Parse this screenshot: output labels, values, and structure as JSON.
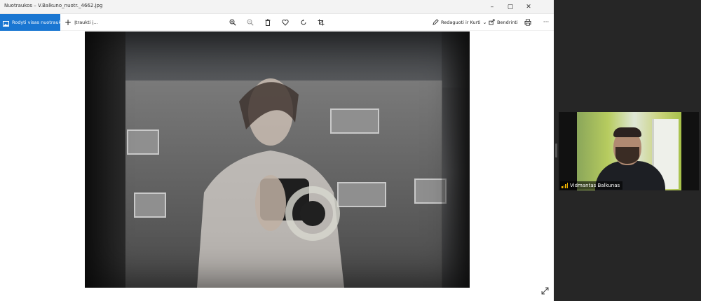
{
  "app": {
    "title": "Nuotraukos – V.Balkuno_nuotr._4662.jpg",
    "window_buttons": {
      "minimize": "–",
      "maximize": "▢",
      "close": "✕"
    },
    "toolbar": {
      "view_all_label": "Rodyti visas nuotraukas",
      "add_label": "Įtraukti į...",
      "edit_create_label": "Redaguoti ir Kurti",
      "share_label": "Bendrinti",
      "icons": [
        "zoom-in-icon",
        "zoom-out-icon",
        "delete-icon",
        "favorite-icon",
        "rotate-icon",
        "crop-icon",
        "print-icon",
        "more-icon"
      ],
      "more_label": "···"
    },
    "colors": {
      "accent": "#1976d2"
    }
  },
  "participant": {
    "name": "Vidmantas Balkunas",
    "audio_indicator_color": "#f0b400"
  }
}
